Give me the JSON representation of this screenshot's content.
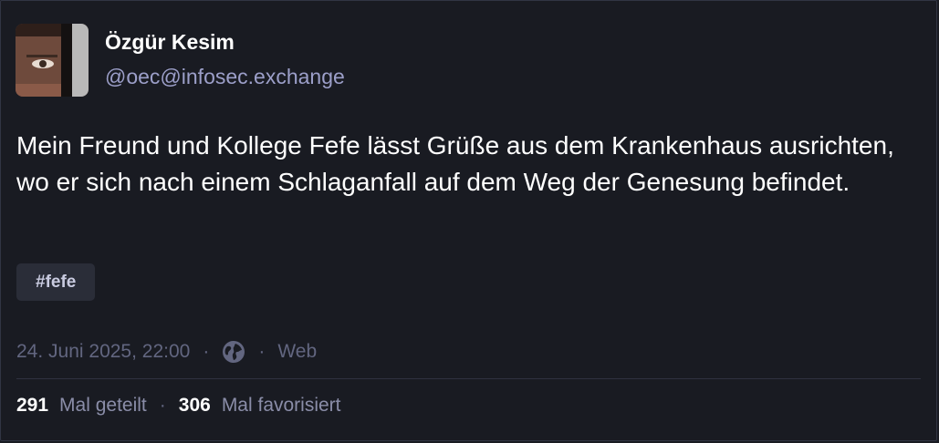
{
  "post": {
    "author": {
      "display_name": "Özgür Kesim",
      "handle": "@oec@infosec.exchange"
    },
    "content": "Mein Freund und Kollege Fefe lässt Grüße aus dem Krankenhaus ausrichten, wo er sich nach einem Schlaganfall auf dem Weg der Genesung befindet.",
    "hashtag": "#fefe",
    "meta": {
      "timestamp": "24. Juni 2025, 22:00",
      "separator": "·",
      "visibility_icon": "globe-icon",
      "client": "Web"
    },
    "stats": {
      "boosts_count": "291",
      "boosts_label": "Mal geteilt",
      "separator": "·",
      "favourites_count": "306",
      "favourites_label": "Mal favorisiert"
    }
  },
  "colors": {
    "background": "#191b22",
    "handle": "#9c9fc9",
    "muted": "#626680",
    "hashtag_bg": "#2a2d38"
  }
}
